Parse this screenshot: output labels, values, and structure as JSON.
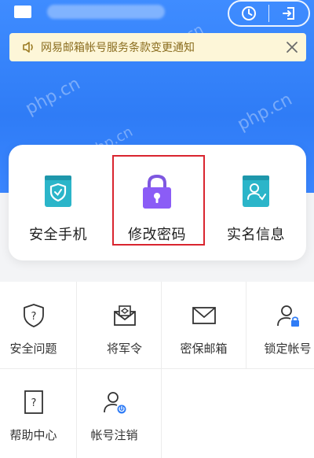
{
  "top": {
    "account_name": "•••••••••••",
    "history_icon": "clock-icon",
    "logout_icon": "exit-icon"
  },
  "notice": {
    "text": "网易邮箱帐号服务条款变更通知",
    "icon": "speaker-icon"
  },
  "watermark": "php.cn",
  "primary": [
    {
      "label": "安全手机",
      "icon": "shield-phone-icon"
    },
    {
      "label": "修改密码",
      "icon": "lock-icon"
    },
    {
      "label": "实名信息",
      "icon": "id-card-icon"
    }
  ],
  "grid": [
    {
      "label": "安全问题",
      "icon": "question-shield-icon"
    },
    {
      "label": "将军令",
      "icon": "token-envelope-icon"
    },
    {
      "label": "密保邮箱",
      "icon": "mail-icon"
    },
    {
      "label": "锁定帐号",
      "icon": "user-lock-icon"
    },
    {
      "label": "帮助中心",
      "icon": "help-doc-icon"
    },
    {
      "label": "帐号注销",
      "icon": "user-power-icon"
    }
  ],
  "colors": {
    "hero_blue": "#2f7cf6",
    "notice_bg": "#fdf6d8",
    "highlight_red": "#d9252f",
    "icon_teal": "#2bb5c9",
    "icon_purple": "#8b5cf6"
  }
}
